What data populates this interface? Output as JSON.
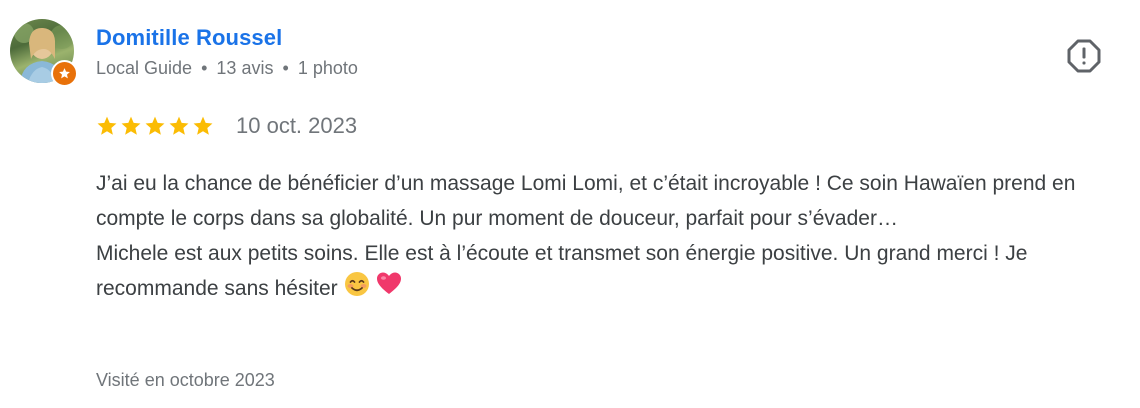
{
  "reviewer": {
    "name": "Domitille Roussel",
    "level": "Local Guide",
    "reviews": "13 avis",
    "photos": "1 photo",
    "separator": "•"
  },
  "rating": {
    "stars": 5,
    "max": 5,
    "date": "10 oct. 2023",
    "star_color": "#fbbc04"
  },
  "review": {
    "paragraph1": "J’ai eu la chance de bénéficier d’un massage Lomi Lomi, et c’était incroyable ! Ce soin Hawaïen prend en compte le corps dans sa globalité. Un pur moment de douceur, parfait pour s’évader…",
    "paragraph2": "Michele est aux petits soins. Elle est à l’écoute et transmet son énergie positive. Un grand merci ! Je recommande sans hésiter",
    "emojis": [
      "smiling-face-icon",
      "heart-icon"
    ]
  },
  "visited": "Visité en octobre 2023",
  "colors": {
    "name": "#1a73e8",
    "badge": "#e8710a",
    "muted": "#70757a"
  }
}
